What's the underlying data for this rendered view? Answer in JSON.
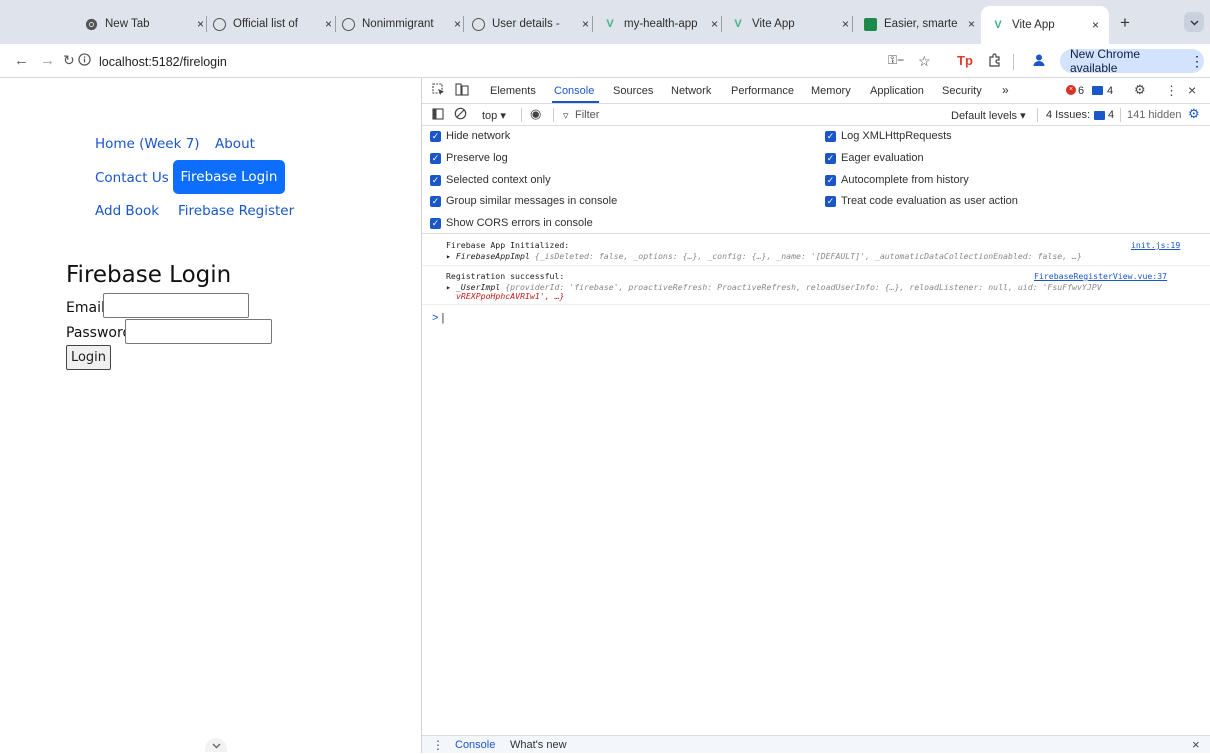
{
  "browser": {
    "tabs": [
      {
        "title": "New Tab",
        "icon": "chrome-icon"
      },
      {
        "title": "Official list of  ",
        "icon": "globe-icon"
      },
      {
        "title": "Nonimmigrant",
        "icon": "globe-icon"
      },
      {
        "title": "User details -  ",
        "icon": "globe-icon"
      },
      {
        "title": "my-health-app",
        "icon": "vue-icon"
      },
      {
        "title": "Vite App",
        "icon": "vue-icon"
      },
      {
        "title": "Easier, smarte",
        "icon": "green-icon"
      },
      {
        "title": "Vite App",
        "icon": "vue-icon",
        "active": true
      }
    ],
    "new_tab_glyph": "+",
    "close_glyph": "×",
    "url": "localhost:5182/firelogin",
    "update_button": "New Chrome available",
    "update_menu_glyph": "⋮",
    "extension_text": "Tp"
  },
  "page": {
    "nav": {
      "home": "Home (Week 7)",
      "about": "About",
      "contact": "Contact Us",
      "firebase_login": "Firebase Login",
      "add_book": "Add Book",
      "firebase_register": "Firebase Register"
    },
    "title": "Firebase Login",
    "email_label": "Email:",
    "password_label": "Password:",
    "login_button": "Login"
  },
  "devtools": {
    "tabs": [
      "Elements",
      "Console",
      "Sources",
      "Network",
      "Performance",
      "Memory",
      "Application",
      "Security"
    ],
    "active_tab": "Console",
    "more_tabs": "»",
    "error_count": "6",
    "message_count": "4",
    "context": "top ▾",
    "filter_placeholder": "Filter",
    "levels": "Default levels ▾",
    "issues_label": "4 Issues:",
    "issues_count": "4",
    "hidden": "141 hidden",
    "settings": {
      "hide_network": "Hide network",
      "preserve_log": "Preserve log",
      "selected_context": "Selected context only",
      "group_similar": "Group similar messages in console",
      "show_cors": "Show CORS errors in console",
      "log_xhr": "Log XMLHttpRequests",
      "eager_eval": "Eager evaluation",
      "autocomplete": "Autocomplete from history",
      "treat_code": "Treat code evaluation as user action"
    },
    "logs": [
      {
        "message": "Firebase App Initialized:",
        "source": "init.js:19",
        "object_name": "FirebaseAppImpl",
        "object_body": "{_isDeleted: false, _options: {…}, _config: {…}, _name: '[DEFAULT]', _automaticDataCollectionEnabled: false, …}"
      },
      {
        "message": "Registration successful:",
        "source": "FirebaseRegisterView.vue:37",
        "object_name": "_UserImpl",
        "object_body": "{providerId: 'firebase', proactiveRefresh: ProactiveRefresh, reloadUserInfo: {…}, reloadListener: null, uid: 'FsuFfwvYJPV",
        "object_body_2": "vREXPpoHphcAVRIw1', …}"
      }
    ],
    "prompt": ">",
    "drawer": {
      "console": "Console",
      "whats_new": "What's new"
    }
  }
}
